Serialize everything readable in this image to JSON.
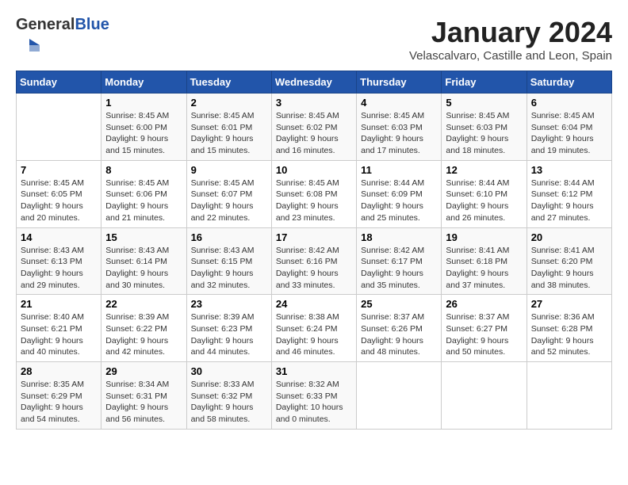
{
  "header": {
    "logo_general": "General",
    "logo_blue": "Blue",
    "month_title": "January 2024",
    "location": "Velascalvaro, Castille and Leon, Spain"
  },
  "days_of_week": [
    "Sunday",
    "Monday",
    "Tuesday",
    "Wednesday",
    "Thursday",
    "Friday",
    "Saturday"
  ],
  "weeks": [
    [
      {
        "num": "",
        "sunrise": "",
        "sunset": "",
        "daylight": ""
      },
      {
        "num": "1",
        "sunrise": "Sunrise: 8:45 AM",
        "sunset": "Sunset: 6:00 PM",
        "daylight": "Daylight: 9 hours and 15 minutes."
      },
      {
        "num": "2",
        "sunrise": "Sunrise: 8:45 AM",
        "sunset": "Sunset: 6:01 PM",
        "daylight": "Daylight: 9 hours and 15 minutes."
      },
      {
        "num": "3",
        "sunrise": "Sunrise: 8:45 AM",
        "sunset": "Sunset: 6:02 PM",
        "daylight": "Daylight: 9 hours and 16 minutes."
      },
      {
        "num": "4",
        "sunrise": "Sunrise: 8:45 AM",
        "sunset": "Sunset: 6:03 PM",
        "daylight": "Daylight: 9 hours and 17 minutes."
      },
      {
        "num": "5",
        "sunrise": "Sunrise: 8:45 AM",
        "sunset": "Sunset: 6:03 PM",
        "daylight": "Daylight: 9 hours and 18 minutes."
      },
      {
        "num": "6",
        "sunrise": "Sunrise: 8:45 AM",
        "sunset": "Sunset: 6:04 PM",
        "daylight": "Daylight: 9 hours and 19 minutes."
      }
    ],
    [
      {
        "num": "7",
        "sunrise": "Sunrise: 8:45 AM",
        "sunset": "Sunset: 6:05 PM",
        "daylight": "Daylight: 9 hours and 20 minutes."
      },
      {
        "num": "8",
        "sunrise": "Sunrise: 8:45 AM",
        "sunset": "Sunset: 6:06 PM",
        "daylight": "Daylight: 9 hours and 21 minutes."
      },
      {
        "num": "9",
        "sunrise": "Sunrise: 8:45 AM",
        "sunset": "Sunset: 6:07 PM",
        "daylight": "Daylight: 9 hours and 22 minutes."
      },
      {
        "num": "10",
        "sunrise": "Sunrise: 8:45 AM",
        "sunset": "Sunset: 6:08 PM",
        "daylight": "Daylight: 9 hours and 23 minutes."
      },
      {
        "num": "11",
        "sunrise": "Sunrise: 8:44 AM",
        "sunset": "Sunset: 6:09 PM",
        "daylight": "Daylight: 9 hours and 25 minutes."
      },
      {
        "num": "12",
        "sunrise": "Sunrise: 8:44 AM",
        "sunset": "Sunset: 6:10 PM",
        "daylight": "Daylight: 9 hours and 26 minutes."
      },
      {
        "num": "13",
        "sunrise": "Sunrise: 8:44 AM",
        "sunset": "Sunset: 6:12 PM",
        "daylight": "Daylight: 9 hours and 27 minutes."
      }
    ],
    [
      {
        "num": "14",
        "sunrise": "Sunrise: 8:43 AM",
        "sunset": "Sunset: 6:13 PM",
        "daylight": "Daylight: 9 hours and 29 minutes."
      },
      {
        "num": "15",
        "sunrise": "Sunrise: 8:43 AM",
        "sunset": "Sunset: 6:14 PM",
        "daylight": "Daylight: 9 hours and 30 minutes."
      },
      {
        "num": "16",
        "sunrise": "Sunrise: 8:43 AM",
        "sunset": "Sunset: 6:15 PM",
        "daylight": "Daylight: 9 hours and 32 minutes."
      },
      {
        "num": "17",
        "sunrise": "Sunrise: 8:42 AM",
        "sunset": "Sunset: 6:16 PM",
        "daylight": "Daylight: 9 hours and 33 minutes."
      },
      {
        "num": "18",
        "sunrise": "Sunrise: 8:42 AM",
        "sunset": "Sunset: 6:17 PM",
        "daylight": "Daylight: 9 hours and 35 minutes."
      },
      {
        "num": "19",
        "sunrise": "Sunrise: 8:41 AM",
        "sunset": "Sunset: 6:18 PM",
        "daylight": "Daylight: 9 hours and 37 minutes."
      },
      {
        "num": "20",
        "sunrise": "Sunrise: 8:41 AM",
        "sunset": "Sunset: 6:20 PM",
        "daylight": "Daylight: 9 hours and 38 minutes."
      }
    ],
    [
      {
        "num": "21",
        "sunrise": "Sunrise: 8:40 AM",
        "sunset": "Sunset: 6:21 PM",
        "daylight": "Daylight: 9 hours and 40 minutes."
      },
      {
        "num": "22",
        "sunrise": "Sunrise: 8:39 AM",
        "sunset": "Sunset: 6:22 PM",
        "daylight": "Daylight: 9 hours and 42 minutes."
      },
      {
        "num": "23",
        "sunrise": "Sunrise: 8:39 AM",
        "sunset": "Sunset: 6:23 PM",
        "daylight": "Daylight: 9 hours and 44 minutes."
      },
      {
        "num": "24",
        "sunrise": "Sunrise: 8:38 AM",
        "sunset": "Sunset: 6:24 PM",
        "daylight": "Daylight: 9 hours and 46 minutes."
      },
      {
        "num": "25",
        "sunrise": "Sunrise: 8:37 AM",
        "sunset": "Sunset: 6:26 PM",
        "daylight": "Daylight: 9 hours and 48 minutes."
      },
      {
        "num": "26",
        "sunrise": "Sunrise: 8:37 AM",
        "sunset": "Sunset: 6:27 PM",
        "daylight": "Daylight: 9 hours and 50 minutes."
      },
      {
        "num": "27",
        "sunrise": "Sunrise: 8:36 AM",
        "sunset": "Sunset: 6:28 PM",
        "daylight": "Daylight: 9 hours and 52 minutes."
      }
    ],
    [
      {
        "num": "28",
        "sunrise": "Sunrise: 8:35 AM",
        "sunset": "Sunset: 6:29 PM",
        "daylight": "Daylight: 9 hours and 54 minutes."
      },
      {
        "num": "29",
        "sunrise": "Sunrise: 8:34 AM",
        "sunset": "Sunset: 6:31 PM",
        "daylight": "Daylight: 9 hours and 56 minutes."
      },
      {
        "num": "30",
        "sunrise": "Sunrise: 8:33 AM",
        "sunset": "Sunset: 6:32 PM",
        "daylight": "Daylight: 9 hours and 58 minutes."
      },
      {
        "num": "31",
        "sunrise": "Sunrise: 8:32 AM",
        "sunset": "Sunset: 6:33 PM",
        "daylight": "Daylight: 10 hours and 0 minutes."
      },
      {
        "num": "",
        "sunrise": "",
        "sunset": "",
        "daylight": ""
      },
      {
        "num": "",
        "sunrise": "",
        "sunset": "",
        "daylight": ""
      },
      {
        "num": "",
        "sunrise": "",
        "sunset": "",
        "daylight": ""
      }
    ]
  ]
}
